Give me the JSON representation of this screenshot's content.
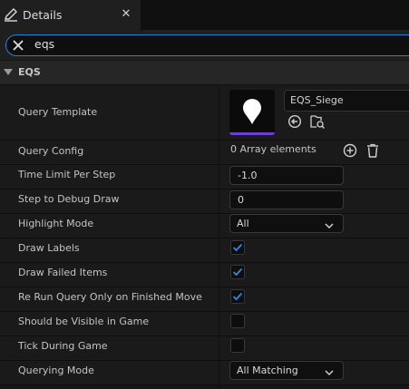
{
  "tab": {
    "title": "Details",
    "icon": "pencil-icon",
    "close": "✕"
  },
  "search": {
    "value": "eqs"
  },
  "category": {
    "label": "EQS"
  },
  "properties": [
    {
      "label": "Query Template"
    },
    {
      "label": "Query Config"
    },
    {
      "label": "Time Limit Per Step"
    },
    {
      "label": "Step to Debug Draw"
    },
    {
      "label": "Highlight Mode"
    },
    {
      "label": "Draw Labels"
    },
    {
      "label": "Draw Failed Items"
    },
    {
      "label": "Re Run Query Only on Finished Move"
    },
    {
      "label": "Should be Visible in Game"
    },
    {
      "label": "Tick During Game"
    },
    {
      "label": "Querying Mode"
    }
  ],
  "values": {
    "query_template": "EQS_Siege",
    "query_config": "0 Array elements",
    "time_limit": "-1.0",
    "step_debug": "0",
    "highlight_mode": "All",
    "draw_labels": true,
    "draw_failed_items": true,
    "rerun_query": true,
    "visible_in_game": false,
    "tick_during_game": false,
    "querying_mode": "All Matching"
  },
  "colors": {
    "accent": "#2e7fd6",
    "asset_bar": "#6f3ed2",
    "check": "#2e8ae6"
  }
}
